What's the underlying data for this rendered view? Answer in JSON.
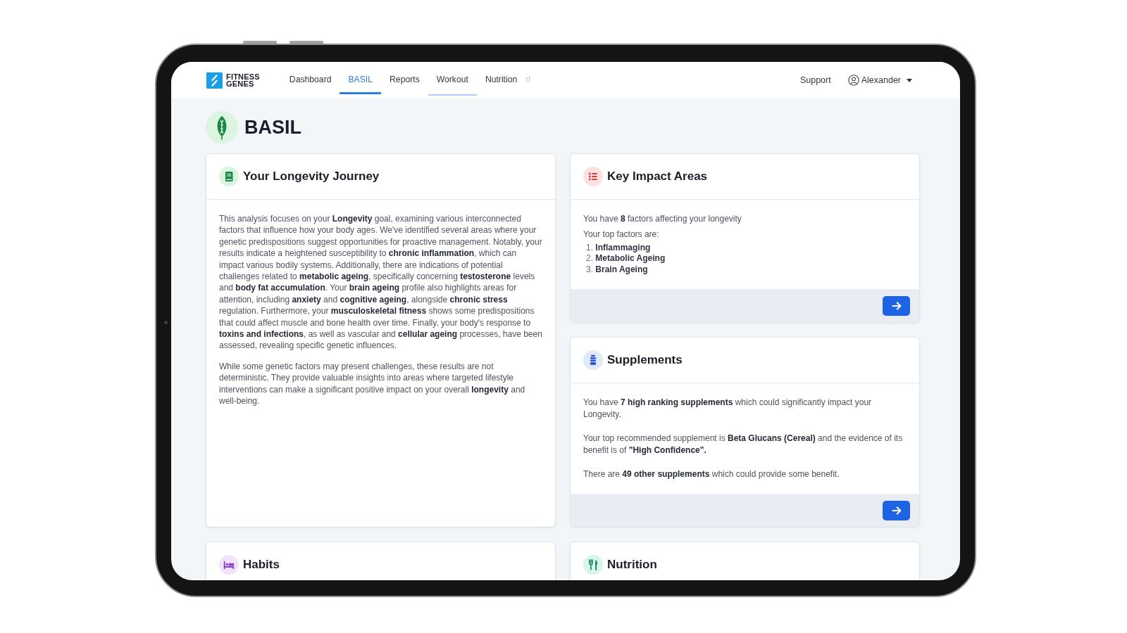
{
  "nav": {
    "brand": [
      "FITNESS",
      "GENES"
    ],
    "items": [
      {
        "label": "Dashboard",
        "selected": false,
        "hovered": false,
        "faded": false
      },
      {
        "label": "BASIL",
        "selected": true,
        "hovered": false,
        "faded": false
      },
      {
        "label": "Reports",
        "selected": false,
        "hovered": false,
        "faded": false
      },
      {
        "label": "Workout",
        "selected": false,
        "hovered": true,
        "faded": false
      },
      {
        "label": "Nutrition",
        "selected": false,
        "hovered": false,
        "faded": false
      },
      {
        "label": "rl",
        "selected": false,
        "hovered": false,
        "faded": true
      }
    ],
    "support": {
      "label": "Support"
    },
    "user": {
      "name": "Alexander"
    }
  },
  "page": {
    "title": "BASIL"
  },
  "cards": [
    {
      "kind": "plain",
      "title": "Your Longevity Journey",
      "blocks": [
        {
          "kind": "paragraph",
          "text": "This analysis focuses on your **Longevity** goal, examining various interconnected factors that influence how your body ages. We've identified several areas where your genetic predispositions suggest opportunities for proactive management. Notably, your results indicate a heightened susceptibility to **chronic inflammation**, which can impact various bodily systems. Additionally, there are indications of potential challenges related to **metabolic ageing**, specifically concerning **testosterone** levels and **body fat accumulation**. Your **brain ageing** profile also highlights areas for attention, including **anxiety** and **cognitive ageing**, alongside **chronic stress** regulation. Furthermore, your **musculoskeletal fitness** shows some predispositions that could affect muscle and bone health over time. Finally, your body's response to **toxins and infections**, as well as vascular and **cellular ageing** processes, have been assessed, revealing specific genetic influences."
        },
        {
          "kind": "paragraph",
          "text": "While some genetic factors may present challenges, these results are not deterministic. They provide valuable insights into areas where targeted lifestyle interventions can make a significant positive impact on your overall **longevity** and well-being."
        }
      ]
    },
    {
      "kind": "linked",
      "title": "Key Impact Areas",
      "blocks": [
        {
          "kind": "line",
          "text": "You have **8** factors affecting your longevity"
        },
        {
          "kind": "line",
          "text": "Your top factors are:"
        },
        {
          "kind": "list",
          "items": [
            {
              "number": "1.",
              "label": "Inflammaging"
            },
            {
              "number": "2.",
              "label": "Metabolic Ageing"
            },
            {
              "number": "3.",
              "label": "Brain Ageing"
            }
          ]
        }
      ]
    },
    {
      "kind": "linked",
      "title": "Supplements",
      "blocks": [
        {
          "kind": "paragraph",
          "text": "You have **7 high ranking supplements** which could significantly impact your Longevity."
        },
        {
          "kind": "paragraph",
          "text": "Your top recommended supplement is **Beta Glucans (Cereal)** and the evidence of its benefit is of **\"High Confidence\".**"
        },
        {
          "kind": "paragraph",
          "text": "There are **49 other supplements** which could provide some benefit."
        }
      ]
    },
    {
      "kind": "plain",
      "title": "Habits"
    },
    {
      "kind": "plain",
      "title": "Nutrition"
    }
  ]
}
